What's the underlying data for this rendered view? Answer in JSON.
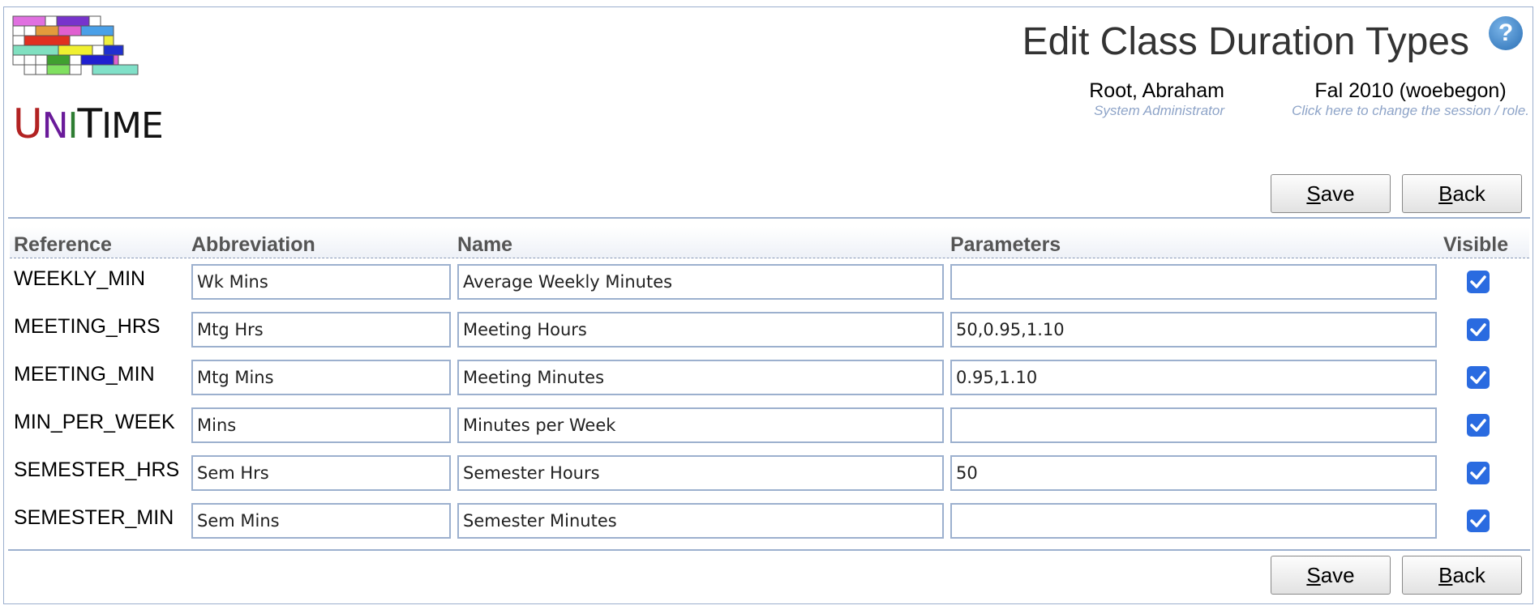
{
  "header": {
    "title": "Edit Class Duration Types",
    "logo_text": "UniTime",
    "user": {
      "name": "Root, Abraham",
      "role": "System Administrator"
    },
    "session": {
      "name": "Fal 2010 (woebegon)",
      "hint": "Click here to change the session / role."
    }
  },
  "buttons": {
    "save_label": "Save",
    "back_label": "Back"
  },
  "table": {
    "columns": [
      "Reference",
      "Abbreviation",
      "Name",
      "Parameters",
      "Visible"
    ],
    "rows": [
      {
        "reference": "WEEKLY_MIN",
        "abbreviation": "Wk Mins",
        "name": "Average Weekly Minutes",
        "parameters": "",
        "visible": true
      },
      {
        "reference": "MEETING_HRS",
        "abbreviation": "Mtg Hrs",
        "name": "Meeting Hours",
        "parameters": "50,0.95,1.10",
        "visible": true
      },
      {
        "reference": "MEETING_MIN",
        "abbreviation": "Mtg Mins",
        "name": "Meeting Minutes",
        "parameters": "0.95,1.10",
        "visible": true
      },
      {
        "reference": "MIN_PER_WEEK",
        "abbreviation": "Mins",
        "name": "Minutes per Week",
        "parameters": "",
        "visible": true
      },
      {
        "reference": "SEMESTER_HRS",
        "abbreviation": "Sem Hrs",
        "name": "Semester Hours",
        "parameters": "50",
        "visible": true
      },
      {
        "reference": "SEMESTER_MIN",
        "abbreviation": "Sem Mins",
        "name": "Semester Minutes",
        "parameters": "",
        "visible": true
      }
    ]
  },
  "colors": {
    "border": "#9CB0CE",
    "checkbox": "#2a6be0",
    "hint": "#8ea4c8"
  }
}
